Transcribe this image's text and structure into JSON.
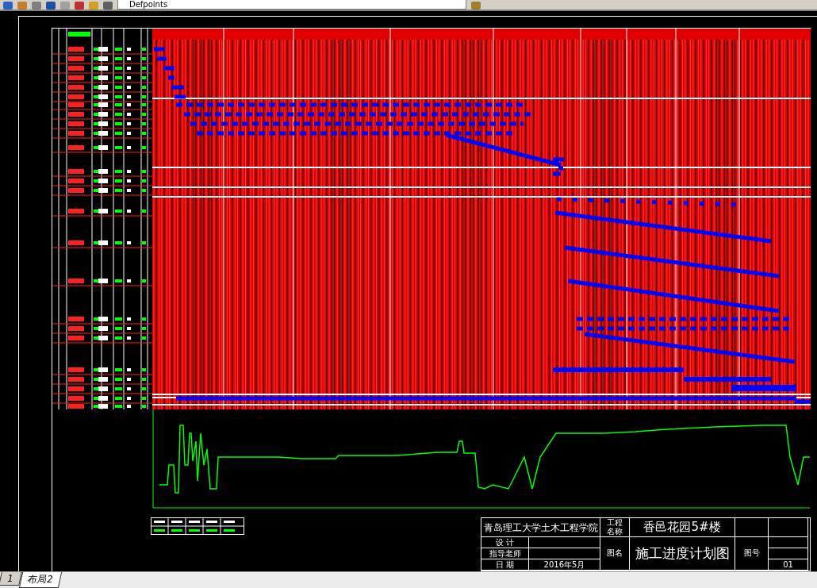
{
  "toolbar": {
    "layer": "Defpoints"
  },
  "title_block": {
    "school": "青岛理工大学土木工程学院",
    "project_label": "工程名称",
    "project": "香邑花园5#楼",
    "rows": [
      {
        "label": "设 计"
      },
      {
        "label": "指导老师"
      },
      {
        "label": "日 期",
        "value": "2016年5月"
      }
    ],
    "drawing_label": "图名",
    "drawing_title": "施工进度计划图",
    "number_label": "图号",
    "number": "01"
  },
  "tabs": [
    {
      "label": "1",
      "selected": false
    },
    {
      "label": "布局2",
      "selected": true
    }
  ]
}
